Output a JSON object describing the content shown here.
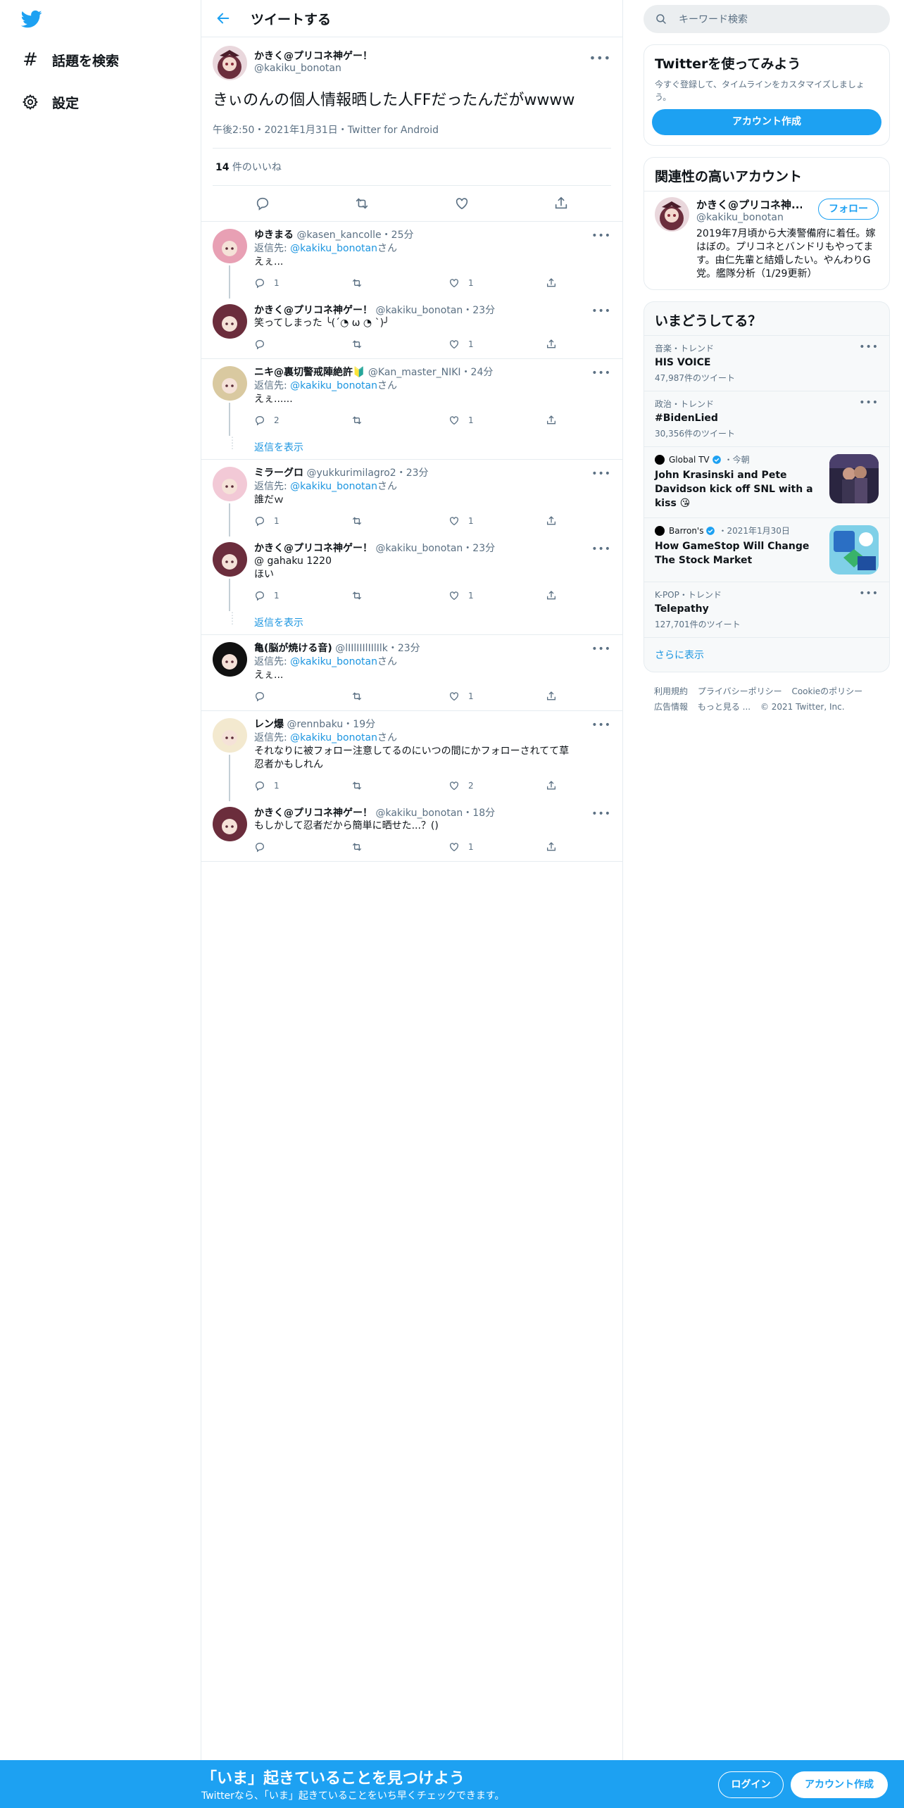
{
  "colors": {
    "accent": "#1da1f2",
    "link": "#1b95e0",
    "muted": "#5b7083",
    "border": "#e6ecf0"
  },
  "nav": {
    "items": [
      {
        "icon": "hashtag-icon",
        "label": "話題を検索"
      },
      {
        "icon": "gear-icon",
        "label": "設定"
      }
    ]
  },
  "header": {
    "title": "ツイートする"
  },
  "focal_tweet": {
    "name": "かきく@プリコネ神ゲー！",
    "handle": "@kakiku_bonotan",
    "text": "きぃのんの個人情報晒した人FFだったんだがwwww",
    "meta": "午後2:50・2021年1月31日・Twitter for Android",
    "likes_count": "14",
    "likes_label": " 件のいいね"
  },
  "reply_prefix": "返信先: ",
  "reply_suffix": "さん",
  "show_replies_label": "返信を表示",
  "replies": [
    {
      "name": "ゆきまる",
      "handle": "@kasen_kancolle",
      "time": "・25分",
      "reply_to": "@kakiku_bonotan",
      "text": "えぇ...",
      "reply_count": "1",
      "retweet_count": "",
      "like_count": "1"
    },
    {
      "name": "かきく@プリコネ神ゲー！",
      "handle": "@kakiku_bonotan",
      "time": "・23分",
      "reply_to": "",
      "text": "笑ってしまった ╰(´◔ ω ◔ `)╯",
      "reply_count": "",
      "retweet_count": "",
      "like_count": "1"
    },
    {
      "name": "ニキ@裏切警戒陣絶許🔰",
      "handle": "@Kan_master_NIKI",
      "time": "・24分",
      "reply_to": "@kakiku_bonotan",
      "text": "えぇ......",
      "reply_count": "2",
      "retweet_count": "",
      "like_count": "1"
    },
    {
      "name": "ミラーグロ",
      "handle": "@yukkurimilagro2",
      "time": "・23分",
      "reply_to": "@kakiku_bonotan",
      "text": "誰だｗ",
      "reply_count": "1",
      "retweet_count": "",
      "like_count": "1"
    },
    {
      "name": "かきく@プリコネ神ゲー！",
      "handle": "@kakiku_bonotan",
      "time": "・23分",
      "reply_to": "",
      "text": "@ gahaku 1220\nほい",
      "reply_count": "1",
      "retweet_count": "",
      "like_count": "1"
    },
    {
      "name": "亀(脳が焼ける音)",
      "handle": "@lIIlIIIlIIlIlk",
      "time": "・23分",
      "reply_to": "@kakiku_bonotan",
      "text": "えぇ...",
      "reply_count": "",
      "retweet_count": "",
      "like_count": "1"
    },
    {
      "name": "レン爆",
      "handle": "@rennbaku",
      "time": "・19分",
      "reply_to": "@kakiku_bonotan",
      "text": "それなりに被フォロー注意してるのにいつの間にかフォローされてて草\n忍者かもしれん",
      "reply_count": "1",
      "retweet_count": "",
      "like_count": "2"
    },
    {
      "name": "かきく@プリコネ神ゲー！",
      "handle": "@kakiku_bonotan",
      "time": "・18分",
      "reply_to": "",
      "text": "もしかして忍者だから簡単に晒せた...？()",
      "reply_count": "",
      "retweet_count": "",
      "like_count": "1"
    }
  ],
  "search": {
    "placeholder": "キーワード検索"
  },
  "signup_card": {
    "title": "Twitterを使ってみよう",
    "subtitle": "今すぐ登録して、タイムラインをカスタマイズしましょう。",
    "button": "アカウント作成"
  },
  "related_card": {
    "title": "関連性の高いアカウント",
    "account": {
      "name": "かきく@プリコネ神...",
      "handle": "@kakiku_bonotan",
      "bio": "2019年7月頃から大湊警備府に着任。嫁はぼの。プリコネとバンドリもやってます。由仁先輩と結婚したい。やんわりG党。艦隊分析（1/29更新）",
      "follow_label": "フォロー"
    }
  },
  "trends_card": {
    "title": "いまどうしてる？",
    "trends": [
      {
        "context": "音楽・トレンド",
        "name": "HIS VOICE",
        "count": "47,987件のツイート"
      },
      {
        "context": "政治・トレンド",
        "name": "#BidenLied",
        "count": "30,356件のツイート"
      }
    ],
    "media_trends": [
      {
        "source": "Global TV",
        "time": "・今朝",
        "title": "John Krasinski and Pete Davidson kick off SNL with a kiss 😘"
      },
      {
        "source": "Barron's",
        "time": "・2021年1月30日",
        "title": "How GameStop Will Change The Stock Market"
      }
    ],
    "trends2": [
      {
        "context": "K-POP・トレンド",
        "name": "Telepathy",
        "count": "127,701件のツイート"
      }
    ],
    "show_more": "さらに表示"
  },
  "footer": {
    "links": [
      "利用規約",
      "プライバシーポリシー",
      "Cookieのポリシー",
      "広告情報",
      "もっと見る ...",
      "© 2021 Twitter, Inc."
    ]
  },
  "banner": {
    "title": "「いま」起きていることを見つけよう",
    "subtitle": "Twitterなら、「いま」起きていることをいち早くチェックできます。",
    "login": "ログイン",
    "signup": "アカウント作成"
  }
}
